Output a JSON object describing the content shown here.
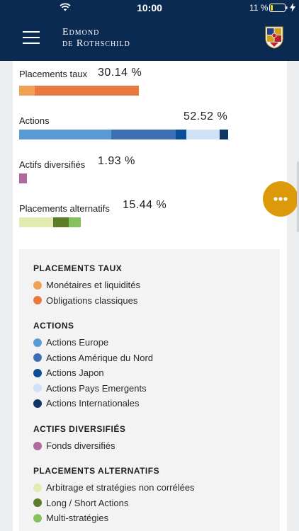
{
  "status_bar": {
    "time": "10:00",
    "battery": "11 %"
  },
  "header": {
    "logo_line1": "Edmond",
    "logo_line2": "de Rothschild"
  },
  "allocations": [
    {
      "title": "Placements taux",
      "percent": "30.14 %",
      "segments": [
        {
          "color": "#f0a154",
          "fraction": 0.13
        },
        {
          "color": "#e87a3e",
          "fraction": 0.87
        }
      ]
    },
    {
      "title": "Actions",
      "percent": "52.52 %",
      "segments": [
        {
          "color": "#5b9bd5",
          "fraction": 0.44
        },
        {
          "color": "#3d6fb5",
          "fraction": 0.31
        },
        {
          "color": "#0b4d96",
          "fraction": 0.05
        },
        {
          "color": "#cfe2f6",
          "fraction": 0.16
        },
        {
          "color": "#0f3563",
          "fraction": 0.04
        }
      ]
    },
    {
      "title": "Actifs diversifiés",
      "percent": "1.93 %",
      "segments": [
        {
          "color": "#b1699e",
          "fraction": 1.0
        }
      ]
    },
    {
      "title": "Placements alternatifs",
      "percent": "15.44 %",
      "segments": [
        {
          "color": "#e2ebb2",
          "fraction": 0.55
        },
        {
          "color": "#5b7d2a",
          "fraction": 0.26
        },
        {
          "color": "#86c15e",
          "fraction": 0.19
        }
      ]
    }
  ],
  "legend": [
    {
      "heading": "PLACEMENTS TAUX",
      "items": [
        {
          "label": "Monétaires et liquidités",
          "color": "#f0a154"
        },
        {
          "label": "Obligations classiques",
          "color": "#e87a3e"
        }
      ]
    },
    {
      "heading": "ACTIONS",
      "items": [
        {
          "label": "Actions Europe",
          "color": "#5b9bd5"
        },
        {
          "label": "Actions Amérique du Nord",
          "color": "#3d6fb5"
        },
        {
          "label": "Actions Japon",
          "color": "#0b4d96"
        },
        {
          "label": "Actions Pays Emergents",
          "color": "#cfe2f6"
        },
        {
          "label": "Actions Internationales",
          "color": "#0f3563"
        }
      ]
    },
    {
      "heading": "ACTIFS DIVERSIFIÉS",
      "items": [
        {
          "label": "Fonds diversifiés",
          "color": "#b1699e"
        }
      ]
    },
    {
      "heading": "PLACEMENTS ALTERNATIFS",
      "items": [
        {
          "label": "Arbitrage et stratégies non corrélées",
          "color": "#e2ebb2"
        },
        {
          "label": "Long / Short Actions",
          "color": "#5b7d2a"
        },
        {
          "label": "Multi-stratégies",
          "color": "#86c15e"
        }
      ]
    }
  ]
}
